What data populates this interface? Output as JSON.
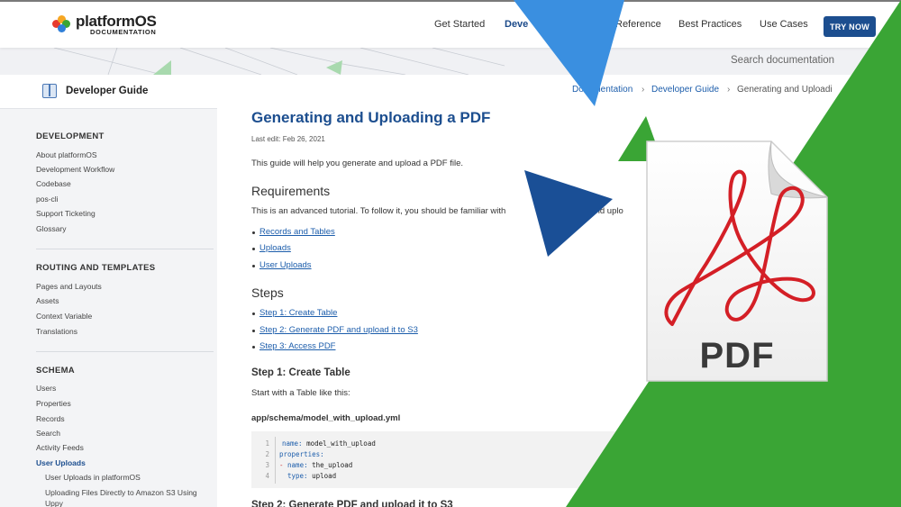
{
  "header": {
    "logo_main": "platformOS",
    "logo_sub": "DOCUMENTATION",
    "nav": {
      "get_started": "Get Started",
      "developer_partial": "Deve",
      "reference_partial": "Reference",
      "best_practices": "Best Practices",
      "use_cases": "Use Cases"
    },
    "cta": "TRY NOW",
    "search_placeholder": "Search documentation"
  },
  "sidebar": {
    "title": "Developer Guide",
    "sections": [
      {
        "title": "DEVELOPMENT",
        "items": [
          "About platformOS",
          "Development Workflow",
          "Codebase",
          "pos-cli",
          "Support Ticketing",
          "Glossary"
        ]
      },
      {
        "title": "ROUTING AND TEMPLATES",
        "items": [
          "Pages and Layouts",
          "Assets",
          "Context Variable",
          "Translations"
        ]
      },
      {
        "title": "SCHEMA",
        "items": [
          "Users",
          "Properties",
          "Records",
          "Search",
          "Activity Feeds",
          "User Uploads"
        ]
      }
    ],
    "active_item": "User Uploads",
    "sub_items": [
      "User Uploads in platformOS",
      "Uploading Files Directly to Amazon S3 Using",
      "Uppy"
    ]
  },
  "breadcrumb": {
    "items": [
      "Documentation",
      "Developer Guide",
      "Generating and Uploadi"
    ],
    "separator": "›"
  },
  "article": {
    "title": "Generating and Uploading a PDF",
    "last_edit": "Last edit: Feb 26, 2021",
    "intro": "This guide will help you generate and upload a PDF file.",
    "requirements_heading": "Requirements",
    "requirements_text_a": "This is an advanced tutorial. To follow it, you should be familiar with",
    "requirements_text_b": "es, and uplo",
    "requirements_links": [
      "Records and Tables",
      "Uploads",
      "User Uploads"
    ],
    "steps_heading": "Steps",
    "steps_links": [
      "Step 1: Create Table",
      "Step 2: Generate PDF and upload it to S3",
      "Step 3: Access PDF"
    ],
    "step1_heading": "Step 1: Create Table",
    "step1_text": "Start with a Table like this:",
    "file_path": "app/schema/model_with_upload.yml",
    "code": {
      "line_numbers": [
        "1",
        "2",
        "3",
        "4"
      ],
      "line1_key": "name:",
      "line1_val": "model_with_upload",
      "line2_key": "properties:",
      "line3_dash": "-",
      "line3_key": "name:",
      "line3_val": "the_upload",
      "line4_key": "type:",
      "line4_val": "upload"
    },
    "next_heading_partial": "Step 2: Generate PDF and upload it to S3"
  },
  "overlay": {
    "pdf_label": "PDF",
    "colors": {
      "green": "#3aa535",
      "light_blue": "#3a8fe0",
      "dark_blue": "#1a4f96",
      "pdf_red": "#d41f26"
    }
  }
}
